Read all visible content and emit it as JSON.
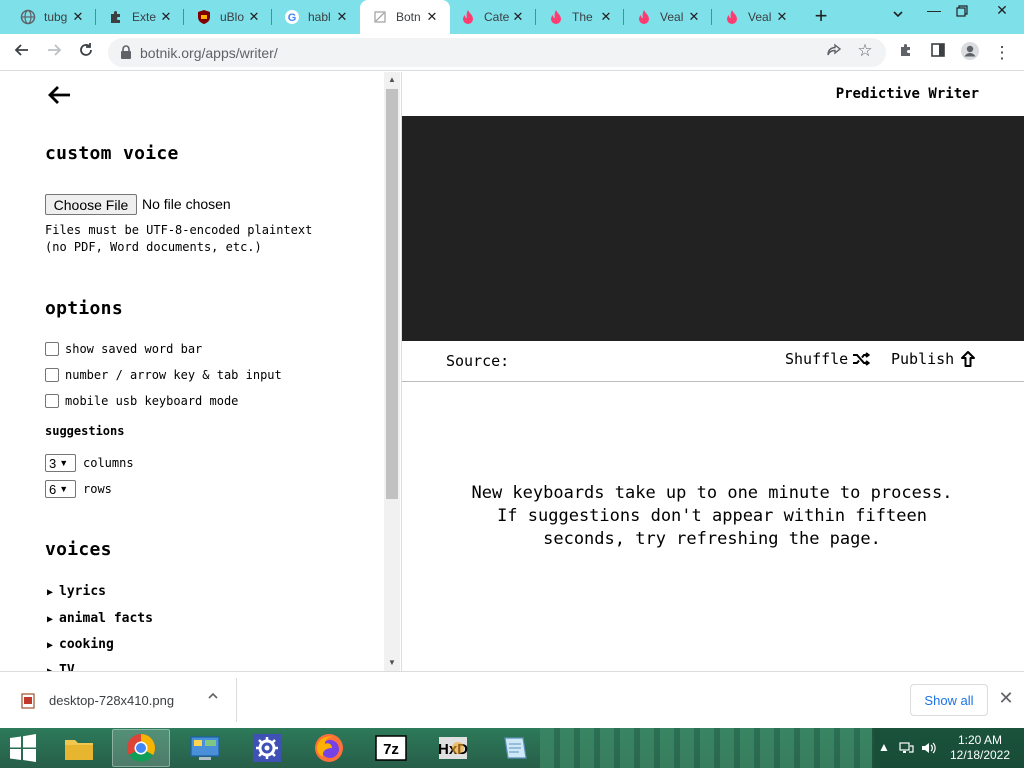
{
  "browser": {
    "tabs": [
      {
        "title": "tubg",
        "icon": "globe-icon"
      },
      {
        "title": "Exte",
        "icon": "puzzle-icon"
      },
      {
        "title": "uBlo",
        "icon": "ublock-icon"
      },
      {
        "title": "habl",
        "icon": "google-icon"
      },
      {
        "title": "Botn",
        "icon": "botnik-icon",
        "active": true
      },
      {
        "title": "Cate",
        "icon": "fire-icon"
      },
      {
        "title": "The",
        "icon": "fire-icon"
      },
      {
        "title": "Veal",
        "icon": "fire-icon"
      },
      {
        "title": "Veal",
        "icon": "fire-icon"
      }
    ],
    "url": "botnik.org/apps/writer/"
  },
  "left_panel": {
    "custom_voice": {
      "heading": "custom voice",
      "choose_file_label": "Choose File",
      "file_status": "No file chosen",
      "note_line1": "Files must be UTF-8-encoded plaintext",
      "note_line2": "(no PDF, Word documents, etc.)"
    },
    "options": {
      "heading": "options",
      "checkboxes": [
        {
          "label": "show saved word bar",
          "checked": false
        },
        {
          "label": "number / arrow key & tab input",
          "checked": false
        },
        {
          "label": "mobile usb keyboard mode",
          "checked": false
        }
      ],
      "suggestions_label": "suggestions",
      "columns": {
        "value": "3",
        "label": "columns"
      },
      "rows": {
        "value": "6",
        "label": "rows"
      }
    },
    "voices": {
      "heading": "voices",
      "items": [
        "lyrics",
        "animal facts",
        "cooking",
        "TV"
      ]
    }
  },
  "right_panel": {
    "title": "Predictive Writer",
    "source_label": "Source:",
    "shuffle_label": "Shuffle",
    "publish_label": "Publish",
    "message": "New keyboards take up to one minute to process. If suggestions don't appear within fifteen seconds, try refreshing the page."
  },
  "download_bar": {
    "filename": "desktop-728x410.png",
    "show_all_label": "Show all"
  },
  "taskbar": {
    "apps": [
      "file-explorer-icon",
      "chrome-icon",
      "control-panel-icon",
      "settings-gear-icon",
      "firefox-icon",
      "7zip-icon",
      "hxd-icon",
      "notepad-icon"
    ],
    "time": "1:20 AM",
    "date": "12/18/2022"
  },
  "colors": {
    "tabstrip": "#7ee0e9",
    "black_area": "#222222",
    "taskbar": "#2d7a5a",
    "link_blue": "#1a73e8"
  }
}
